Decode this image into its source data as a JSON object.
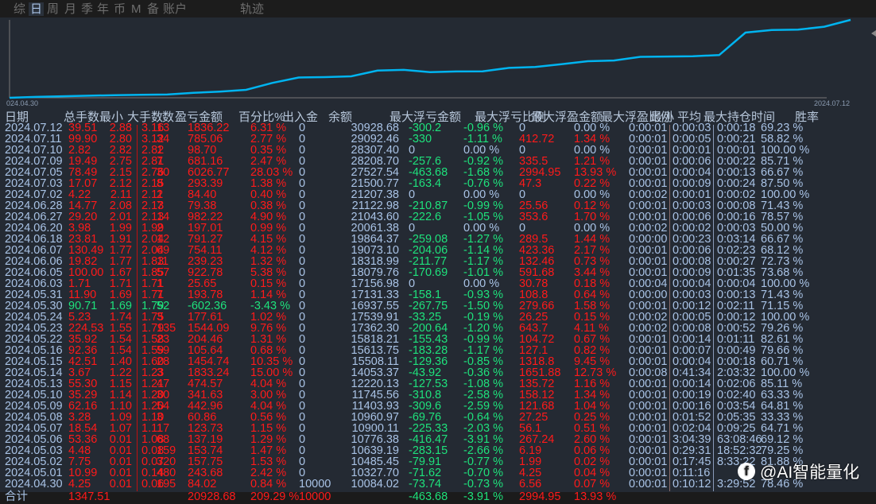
{
  "tabs": [
    "综",
    "日",
    "周",
    "月",
    "季",
    "年",
    "币",
    "M",
    "备",
    "账户",
    "轨迹"
  ],
  "selected_tab": "日",
  "chart": {
    "start_label": "024.04.30",
    "end_label": "2024.07.12",
    "line_color": "#00b4f0"
  },
  "table": {
    "headers": [
      "日期",
      "总手数",
      "最小",
      "大手数",
      "数",
      "盈亏金额",
      "百分比%",
      "出入金",
      "余额",
      "最大浮亏金额",
      "最大浮亏比例",
      "最大浮盈金额",
      "最大浮盈比例",
      "最小",
      "平均",
      "最大持仓时间",
      "胜率"
    ],
    "rows": [
      [
        "2024.07.12",
        "39.51",
        "2.88",
        "3.16",
        "13",
        "1836.22",
        "6.31 %",
        "0",
        "30928.68",
        "-300.2",
        "-0.96 %",
        "0",
        "0.00 %",
        "0:00:01",
        "0:00:03",
        "0:00:18",
        "69.23 %"
      ],
      [
        "2024.07.11",
        "99.90",
        "2.80",
        "3.12",
        "34",
        "785.06",
        "2.77 %",
        "0",
        "29092.46",
        "-330",
        "-1.11 %",
        "412.72",
        "1.34 %",
        "0:00:01",
        "0:00:05",
        "0:00:21",
        "58.82 %"
      ],
      [
        "2024.07.10",
        "2.82",
        "2.82",
        "2.82",
        "1",
        "98.70",
        "0.35 %",
        "0",
        "28307.40",
        "0",
        "0.00 %",
        "0",
        "0.00 %",
        "0:00:01",
        "0:00:01",
        "0:00:01",
        "100.00 %"
      ],
      [
        "2024.07.09",
        "19.49",
        "2.75",
        "2.81",
        "7",
        "681.16",
        "2.47 %",
        "0",
        "28208.70",
        "-257.6",
        "-0.92 %",
        "335.5",
        "1.21 %",
        "0:00:01",
        "0:00:06",
        "0:00:22",
        "85.71 %"
      ],
      [
        "2024.07.05",
        "78.49",
        "2.15",
        "2.76",
        "30",
        "6026.77",
        "28.03 %",
        "0",
        "27527.54",
        "-463.68",
        "-1.68 %",
        "2994.95",
        "13.93 %",
        "0:00:01",
        "0:00:04",
        "0:00:13",
        "66.67 %"
      ],
      [
        "2024.07.03",
        "17.07",
        "2.12",
        "2.15",
        "8",
        "293.39",
        "1.38 %",
        "0",
        "21500.77",
        "-163.4",
        "-0.76 %",
        "47.3",
        "0.22 %",
        "0:00:01",
        "0:00:09",
        "0:00:24",
        "87.50 %"
      ],
      [
        "2024.07.02",
        "4.22",
        "2.11",
        "2.11",
        "2",
        "84.40",
        "0.40 %",
        "0",
        "21207.38",
        "0",
        "0.00 %",
        "0",
        "0.00 %",
        "0:00:02",
        "0:00:01",
        "0:00:02",
        "100.00 %"
      ],
      [
        "2024.06.28",
        "14.77",
        "2.08",
        "2.13",
        "7",
        "79.38",
        "0.38 %",
        "0",
        "21122.98",
        "-210.87",
        "-0.99 %",
        "25.56",
        "0.12 %",
        "0:00:01",
        "0:00:03",
        "0:00:08",
        "71.43 %"
      ],
      [
        "2024.06.27",
        "29.20",
        "2.01",
        "2.13",
        "14",
        "982.22",
        "4.90 %",
        "0",
        "21043.60",
        "-222.6",
        "-1.05 %",
        "353.6",
        "1.70 %",
        "0:00:01",
        "0:00:06",
        "0:00:16",
        "78.57 %"
      ],
      [
        "2024.06.20",
        "3.98",
        "1.99",
        "1.99",
        "2",
        "197.01",
        "0.99 %",
        "0",
        "20061.38",
        "0",
        "0.00 %",
        "0",
        "0.00 %",
        "0:00:02",
        "0:00:02",
        "0:00:03",
        "50.00 %"
      ],
      [
        "2024.06.18",
        "23.81",
        "1.91",
        "2.04",
        "12",
        "791.27",
        "4.15 %",
        "0",
        "19864.37",
        "-259.08",
        "-1.27 %",
        "289.5",
        "1.44 %",
        "0:00:00",
        "0:00:23",
        "0:03:14",
        "66.67 %"
      ],
      [
        "2024.06.07",
        "130.49",
        "1.77",
        "2.04",
        "69",
        "754.11",
        "4.12 %",
        "0",
        "19073.10",
        "-204.06",
        "-1.14 %",
        "423.36",
        "2.17 %",
        "0:00:01",
        "0:00:06",
        "0:02:23",
        "68.12 %"
      ],
      [
        "2024.06.06",
        "19.82",
        "1.77",
        "1.83",
        "11",
        "239.23",
        "1.32 %",
        "0",
        "18318.99",
        "-211.77",
        "-1.17 %",
        "132.46",
        "0.73 %",
        "0:00:01",
        "0:00:08",
        "0:00:27",
        "72.73 %"
      ],
      [
        "2024.06.05",
        "100.00",
        "1.67",
        "1.85",
        "57",
        "922.78",
        "5.38 %",
        "0",
        "18079.76",
        "-170.69",
        "-1.01 %",
        "591.68",
        "3.44 %",
        "0:00:01",
        "0:00:09",
        "0:01:35",
        "73.68 %"
      ],
      [
        "2024.06.03",
        "1.71",
        "1.71",
        "1.71",
        "1",
        "25.65",
        "0.15 %",
        "0",
        "17156.98",
        "0",
        "0.00 %",
        "30.78",
        "0.18 %",
        "0:00:04",
        "0:00:04",
        "0:00:04",
        "100.00 %"
      ],
      [
        "2024.05.31",
        "11.90",
        "1.69",
        "1.71",
        "7",
        "193.78",
        "1.14 %",
        "0",
        "17131.33",
        "-158.1",
        "-0.93 %",
        "108.8",
        "0.64 %",
        "0:00:00",
        "0:00:03",
        "0:00:13",
        "71.43 %"
      ],
      [
        "2024.05.30",
        "90.71",
        "1.69",
        "1.79",
        "52",
        "-602.36",
        "-3.43 %",
        "0",
        "16937.55",
        "-267.75",
        "-1.50 %",
        "279.66",
        "1.58 %",
        "0:00:01",
        "0:00:12",
        "0:02:11",
        "71.15 %"
      ],
      [
        "2024.05.24",
        "5.23",
        "1.74",
        "1.75",
        "3",
        "177.61",
        "1.02 %",
        "0",
        "17539.91",
        "-33.25",
        "-0.19 %",
        "26.25",
        "0.15 %",
        "0:00:02",
        "0:00:05",
        "0:00:12",
        "100.00 %"
      ],
      [
        "2024.05.23",
        "224.53",
        "1.55",
        "1.79",
        "135",
        "1544.09",
        "9.76 %",
        "0",
        "17362.30",
        "-200.64",
        "-1.20 %",
        "643.7",
        "4.11 %",
        "0:00:02",
        "0:00:08",
        "0:00:52",
        "79.26 %"
      ],
      [
        "2024.05.22",
        "35.92",
        "1.54",
        "1.58",
        "23",
        "204.46",
        "1.31 %",
        "0",
        "15818.21",
        "-155.43",
        "-0.99 %",
        "104.72",
        "0.67 %",
        "0:00:01",
        "0:00:14",
        "0:01:11",
        "82.61 %"
      ],
      [
        "2024.05.16",
        "92.36",
        "1.54",
        "1.59",
        "59",
        "105.64",
        "0.68 %",
        "0",
        "15613.75",
        "-183.28",
        "-1.17 %",
        "127.1",
        "0.82 %",
        "0:00:01",
        "0:00:07",
        "0:00:49",
        "79.66 %"
      ],
      [
        "2024.05.15",
        "42.51",
        "1.40",
        "1.60",
        "28",
        "1454.74",
        "10.35 %",
        "0",
        "15508.11",
        "-129.36",
        "-0.85 %",
        "1318.8",
        "9.45 %",
        "0:00:01",
        "0:00:04",
        "0:00:18",
        "60.71 %"
      ],
      [
        "2024.05.14",
        "3.67",
        "1.22",
        "1.23",
        "3",
        "1833.24",
        "15.00 %",
        "0",
        "14053.37",
        "-43.92",
        "-0.36 %",
        "1651.88",
        "12.73 %",
        "0:00:08",
        "0:41:34",
        "2:03:32",
        "100.00 %"
      ],
      [
        "2024.05.13",
        "55.30",
        "1.15",
        "1.21",
        "47",
        "474.57",
        "4.04 %",
        "0",
        "12220.13",
        "-127.53",
        "-1.08 %",
        "135.72",
        "1.16 %",
        "0:00:01",
        "0:00:14",
        "0:02:06",
        "85.11 %"
      ],
      [
        "2024.05.10",
        "35.29",
        "1.14",
        "1.20",
        "30",
        "341.63",
        "3.00 %",
        "0",
        "11745.56",
        "-310.8",
        "-2.58 %",
        "158.12",
        "1.34 %",
        "0:00:01",
        "0:00:19",
        "0:02:40",
        "63.33 %"
      ],
      [
        "2024.05.09",
        "62.16",
        "1.10",
        "1.20",
        "54",
        "442.96",
        "4.04 %",
        "0",
        "11403.93",
        "-309.6",
        "-2.59 %",
        "121.68",
        "1.04 %",
        "0:00:01",
        "0:00:16",
        "0:03:54",
        "64.81 %"
      ],
      [
        "2024.05.08",
        "3.28",
        "1.09",
        "1.10",
        "3",
        "60.86",
        "0.56 %",
        "0",
        "10960.97",
        "-69.76",
        "-0.64 %",
        "27.25",
        "0.25 %",
        "0:00:01",
        "0:01:52",
        "0:05:35",
        "33.33 %"
      ],
      [
        "2024.05.07",
        "18.54",
        "1.07",
        "1.11",
        "17",
        "123.73",
        "1.15 %",
        "0",
        "10900.11",
        "-225.33",
        "-2.03 %",
        "56.1",
        "0.51 %",
        "0:00:01",
        "0:02:04",
        "0:09:25",
        "64.71 %"
      ],
      [
        "2024.05.06",
        "53.36",
        "0.01",
        "1.08",
        "68",
        "137.19",
        "1.29 %",
        "0",
        "10776.38",
        "-416.47",
        "-3.91 %",
        "267.24",
        "2.60 %",
        "0:00:01",
        "3:04:39",
        "63:08:46",
        "69.12 %"
      ],
      [
        "2024.05.03",
        "4.48",
        "0.01",
        "0.08",
        "159",
        "153.74",
        "1.47 %",
        "0",
        "10639.19",
        "-283.15",
        "-2.66 %",
        "6.19",
        "0.06 %",
        "0:00:01",
        "0:29:31",
        "18:52:32",
        "79.25 %"
      ],
      [
        "2024.05.02",
        "7.75",
        "0.01",
        "0.07",
        "320",
        "157.75",
        "1.53 %",
        "0",
        "10485.45",
        "-79.91",
        "-0.77 %",
        "1.99",
        "0.02 %",
        "0:00:01",
        "0:17:45",
        "8:33:22",
        "81.88 %"
      ],
      [
        "2024.05.01",
        "10.99",
        "0.01",
        "0.14",
        "480",
        "243.68",
        "2.42 %",
        "0",
        "10327.70",
        "-71.62",
        "-0.70 %",
        "4.25",
        "0.04 %",
        "0:00:01",
        "0:11:16",
        "",
        ""
      ],
      [
        "2024.04.30",
        "4.25",
        "0.01",
        "0.06",
        "195",
        "84.02",
        "0.84 %",
        "10000",
        "10084.02",
        "-73.74",
        "-0.73 %",
        "6.56",
        "0.07 %",
        "0:00:01",
        "0:10:12",
        "3:29:52",
        "78.46 %"
      ]
    ],
    "footer": [
      "合计",
      "1347.51",
      "",
      "",
      "",
      "20928.68",
      "209.29 %",
      "10000",
      "",
      "-463.68",
      "-3.91 %",
      "2994.95",
      "13.93 %",
      "",
      "",
      "",
      ""
    ]
  },
  "watermark": "@AI智能量化",
  "colors": {
    "positive": "#ff1a1a",
    "negative": "#1ee27c",
    "text": "#a9c3e6"
  }
}
